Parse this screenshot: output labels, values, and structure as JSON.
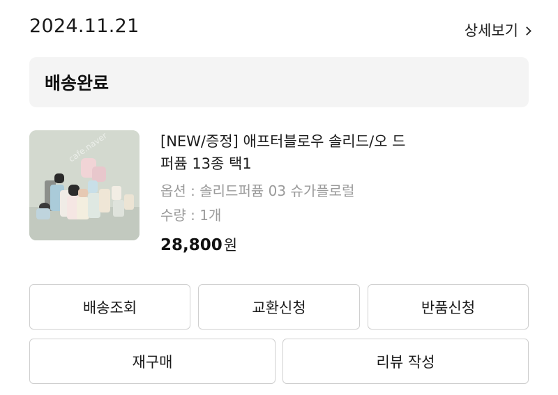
{
  "order": {
    "date": "2024.11.21",
    "detail_link": "상세보기",
    "status": "배송완료"
  },
  "product": {
    "title_line1": "[NEW/증정] 애프터블로우 솔리드/오 드",
    "title_line2": "퍼퓸 13종 택1",
    "option": "옵션 : 솔리드퍼퓸 03 슈가플로럴",
    "quantity": "수량 : 1개",
    "price": "28,800",
    "currency": "원",
    "image_watermark": "cafe.naver"
  },
  "buttons": {
    "track_delivery": "배송조회",
    "exchange_request": "교환신청",
    "return_request": "반품신청",
    "reorder": "재구매",
    "write_review": "리뷰 작성"
  },
  "colors": {
    "banner_bg": "#f4f4f4",
    "muted_text": "#9a9a9a",
    "button_border": "#cfcfcf"
  }
}
